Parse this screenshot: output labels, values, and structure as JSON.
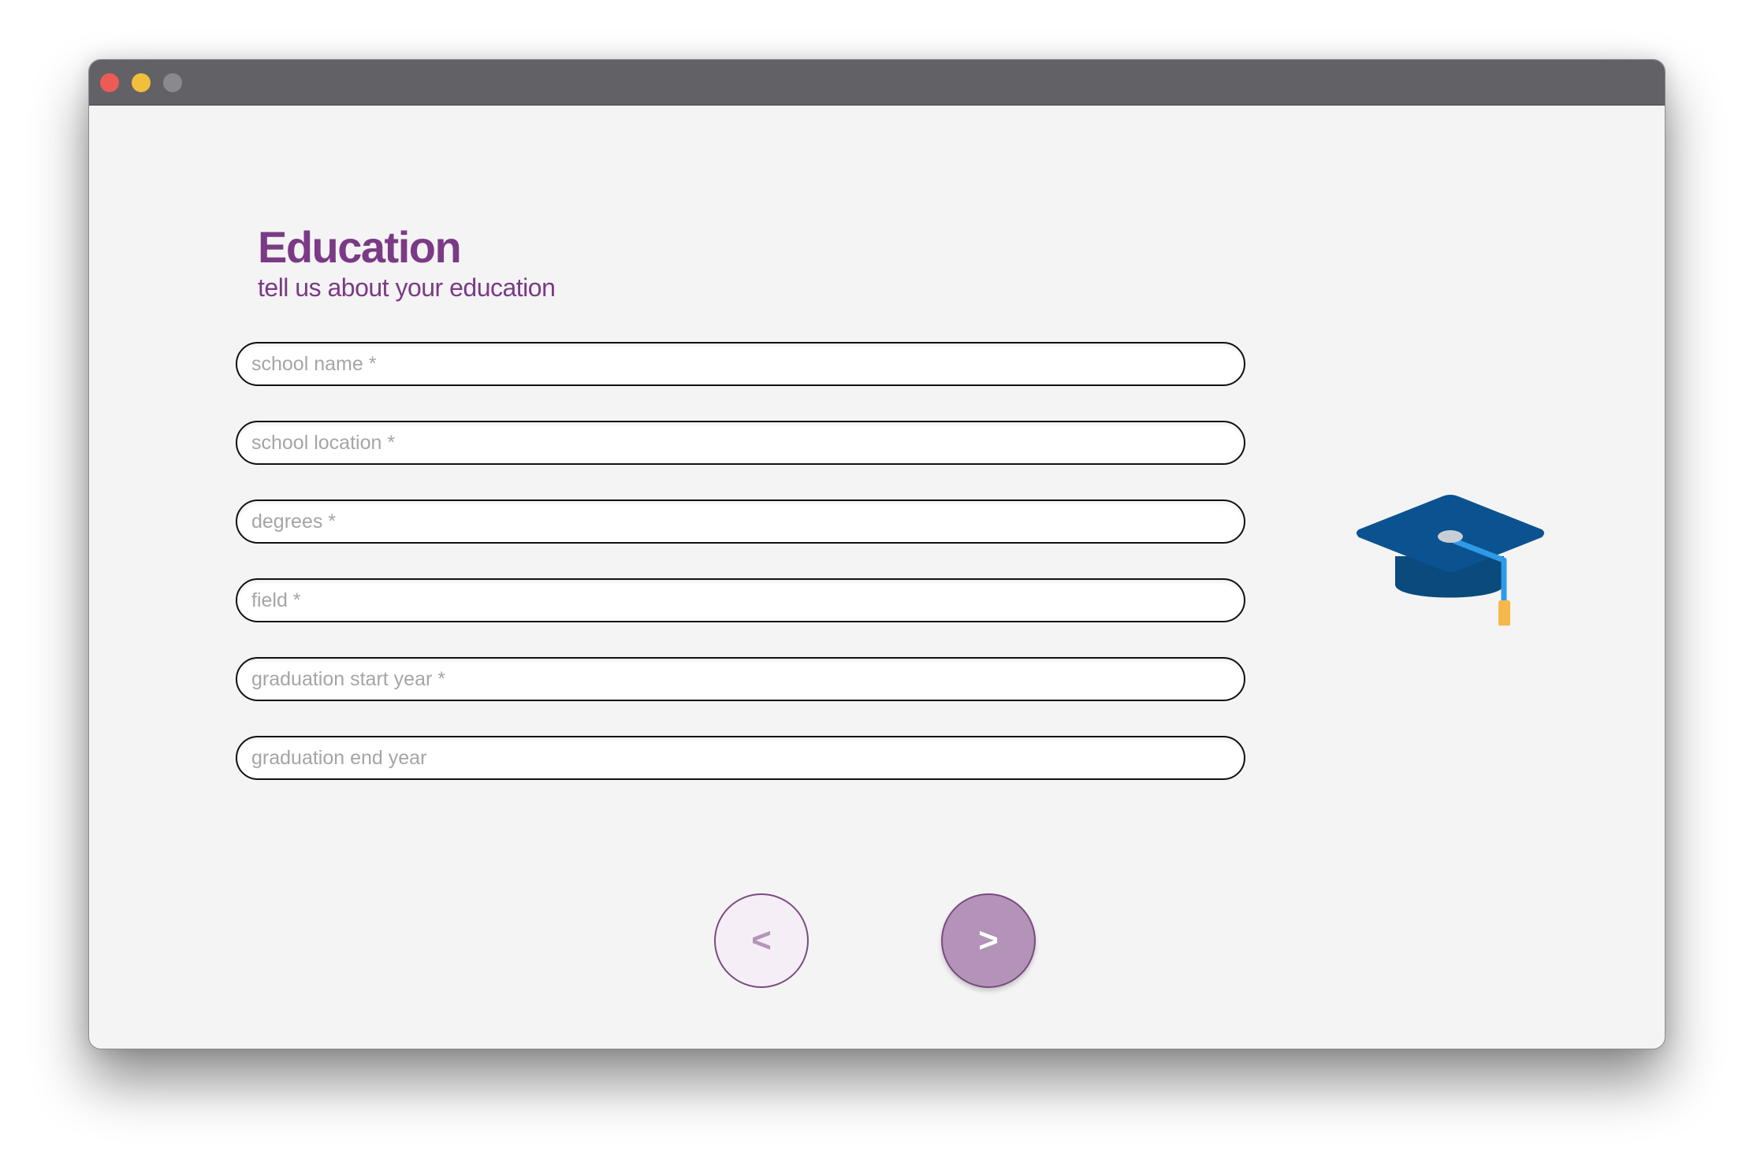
{
  "window": {
    "controls": [
      "close",
      "minimize",
      "zoom"
    ]
  },
  "page": {
    "title": "Education",
    "subtitle": "tell us about your education"
  },
  "form": {
    "fields": [
      {
        "name": "school-name",
        "placeholder": "school name *",
        "value": ""
      },
      {
        "name": "school-location",
        "placeholder": "school location *",
        "value": ""
      },
      {
        "name": "degrees",
        "placeholder": "degrees *",
        "value": ""
      },
      {
        "name": "field",
        "placeholder": "field *",
        "value": ""
      },
      {
        "name": "graduation-start-year",
        "placeholder": "graduation start year *",
        "value": ""
      },
      {
        "name": "graduation-end-year",
        "placeholder": "graduation end year",
        "value": ""
      }
    ]
  },
  "illustration": {
    "icon": "graduation-cap-icon",
    "colors": {
      "cap_top": "#0b5290",
      "cap_base": "#0a4a7c",
      "tassel_cord": "#2f9be8",
      "tassel_end": "#f6b84b",
      "button": "#c8ced6"
    }
  },
  "navigation": {
    "prev_label": "<",
    "next_label": ">"
  },
  "colors": {
    "accent": "#7b3a86",
    "prev_button_bg": "#f5eef6",
    "next_button_bg": "#b493b8",
    "titlebar": "#626166",
    "background": "#f4f4f4"
  }
}
